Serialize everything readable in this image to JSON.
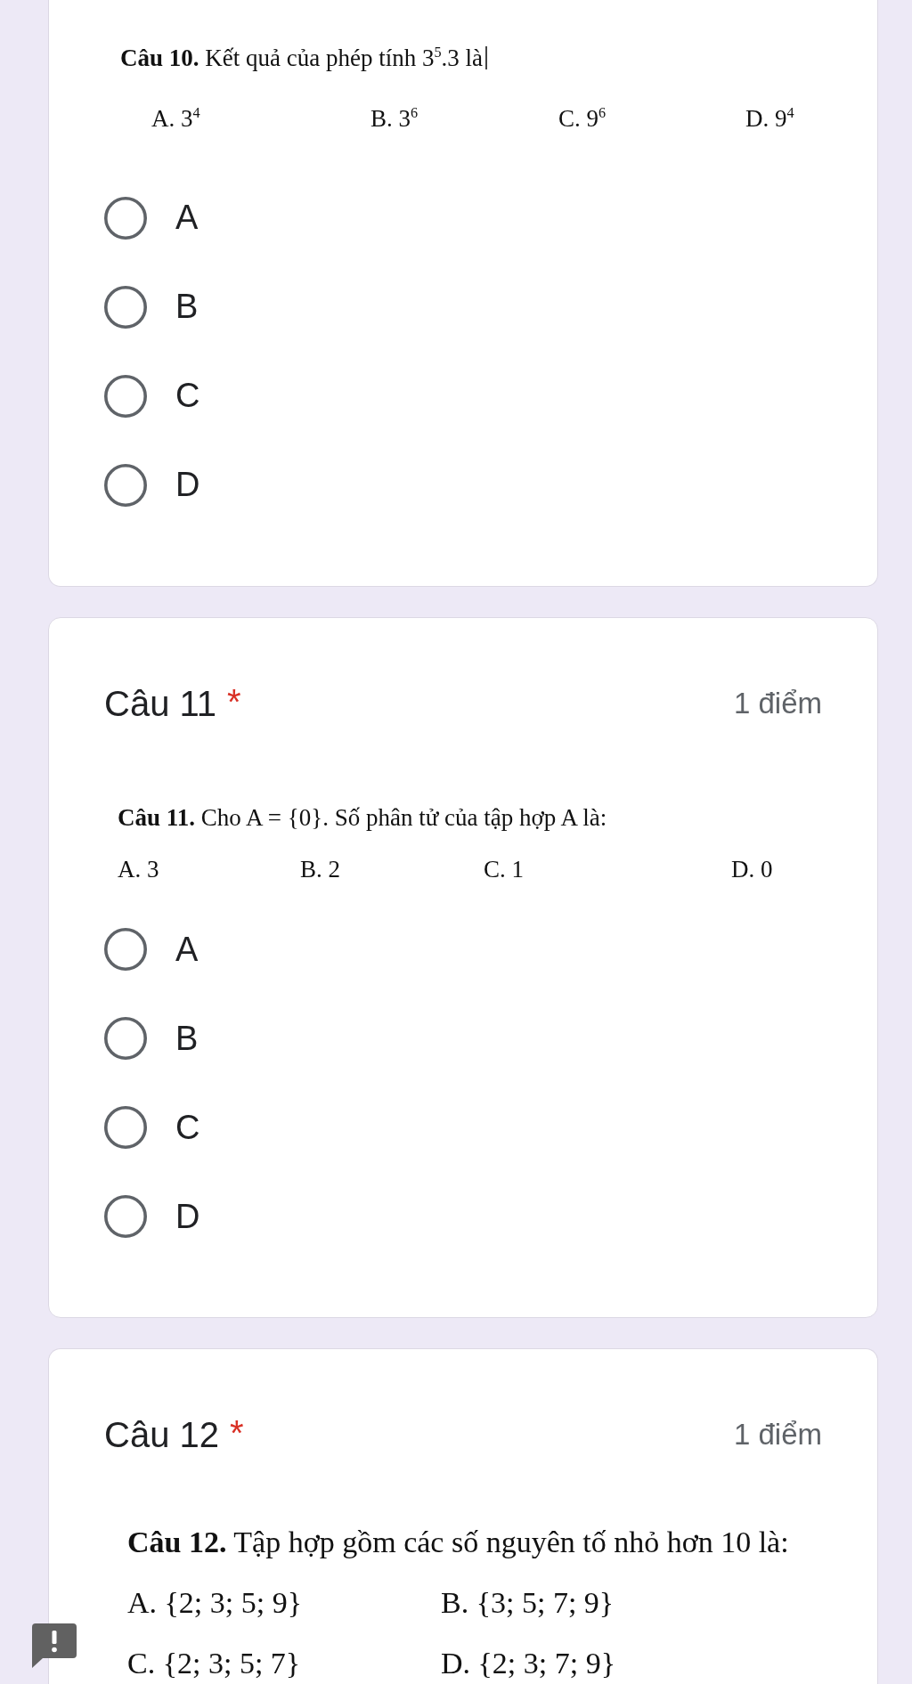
{
  "questions": [
    {
      "image": {
        "text": "**Câu 10.** Kết quả của phép tính 3$^{5}$.3 là",
        "text_cursor": true,
        "option_rows": [
          [
            "A. 3$^{4}$",
            "B. 3$^{6}$",
            "C. 9$^{6}$",
            "D. 9$^{4}$"
          ]
        ]
      },
      "options": [
        {
          "label": "A",
          "selected": false
        },
        {
          "label": "B",
          "selected": false
        },
        {
          "label": "C",
          "selected": false
        },
        {
          "label": "D",
          "selected": false
        }
      ]
    },
    {
      "title": "Câu 11",
      "required_mark": "*",
      "points": "1 điểm",
      "image": {
        "text": "**Câu 11.** Cho A = {0}. Số phân tử của tập hợp A là:",
        "option_rows": [
          [
            "A. 3",
            "B. 2",
            "C. 1",
            "D. 0"
          ]
        ]
      },
      "options": [
        {
          "label": "A",
          "selected": false
        },
        {
          "label": "B",
          "selected": false
        },
        {
          "label": "C",
          "selected": false
        },
        {
          "label": "D",
          "selected": false
        }
      ]
    },
    {
      "title": "Câu 12",
      "required_mark": "*",
      "points": "1 điểm",
      "image": {
        "text": "**Câu 12.** Tập hợp gồm các số nguyên tố nhỏ hơn 10 là:",
        "option_rows": [
          [
            "A. {2; 3; 5; 9}",
            "B. {3; 5; 7; 9}"
          ],
          [
            "C. {2; 3; 5; 7}",
            "D. {2; 3; 7; 9}"
          ]
        ]
      }
    }
  ]
}
